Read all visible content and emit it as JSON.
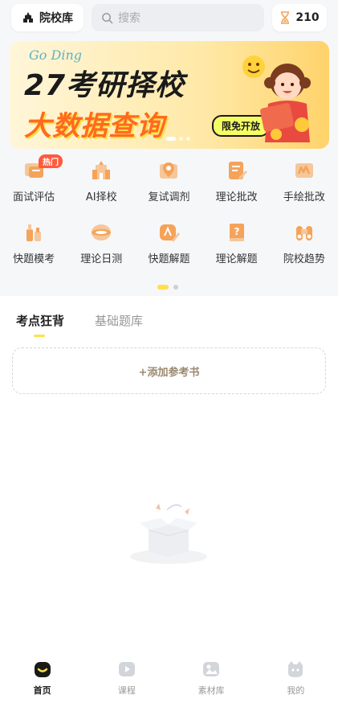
{
  "header": {
    "school_button_label": "院校库",
    "search_placeholder": "搜索",
    "timer_count": "210"
  },
  "banner": {
    "script_text": "Go Ding",
    "title_line1": "27考研择校",
    "title_line2": "大数据查询",
    "badge": "限免开放"
  },
  "features": {
    "hot_badge": "热门",
    "items": [
      {
        "label": "面试评估",
        "icon": "interview-icon"
      },
      {
        "label": "AI择校",
        "icon": "school-icon"
      },
      {
        "label": "复试调剂",
        "icon": "map-pin-icon"
      },
      {
        "label": "理论批改",
        "icon": "edit-doc-icon"
      },
      {
        "label": "手绘批改",
        "icon": "sketch-icon"
      },
      {
        "label": "快题模考",
        "icon": "bottles-icon"
      },
      {
        "label": "理论日测",
        "icon": "lens-icon"
      },
      {
        "label": "快题解题",
        "icon": "brush-icon"
      },
      {
        "label": "理论解题",
        "icon": "question-book-icon"
      },
      {
        "label": "院校趋势",
        "icon": "binoculars-icon"
      }
    ]
  },
  "content": {
    "tabs": [
      {
        "label": "考点狂背",
        "active": true
      },
      {
        "label": "基础题库",
        "active": false
      }
    ],
    "add_book_label": "+添加参考书"
  },
  "tabbar": {
    "items": [
      {
        "label": "首页",
        "icon": "home-icon",
        "active": true
      },
      {
        "label": "课程",
        "icon": "course-icon",
        "active": false
      },
      {
        "label": "素材库",
        "icon": "gallery-icon",
        "active": false
      },
      {
        "label": "我的",
        "icon": "profile-icon",
        "active": false
      }
    ]
  },
  "colors": {
    "accent": "#ffe04b",
    "hot_badge": "#ff5a3c",
    "icon_orange": "#f5a35a"
  }
}
